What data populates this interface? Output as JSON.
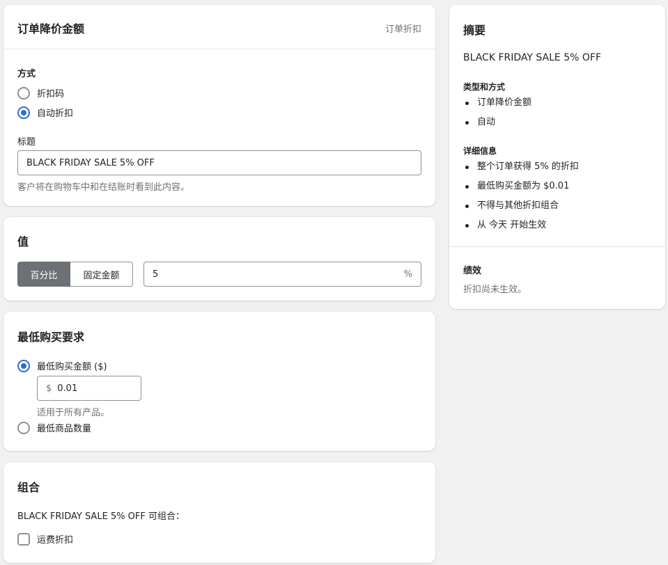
{
  "method_card": {
    "title": "订单降价金额",
    "tag": "订单折扣",
    "method_label": "方式",
    "option_code": "折扣码",
    "option_auto": "自动折扣",
    "title_label": "标题",
    "title_value": "BLACK FRIDAY SALE 5% OFF",
    "help_text": "客户将在购物车中和在结账时看到此内容。"
  },
  "value_card": {
    "title": "值",
    "percent_label": "百分比",
    "fixed_label": "固定金额",
    "value": "5",
    "suffix": "%"
  },
  "min_card": {
    "title": "最低购买要求",
    "option_amount": "最低购买金额 ($)",
    "currency": "$",
    "amount_value": "0.01",
    "help_text": "适用于所有产品。",
    "option_qty": "最低商品数量"
  },
  "combo_card": {
    "title": "组合",
    "text": "BLACK FRIDAY SALE 5% OFF 可组合：",
    "shipping_label": "运费折扣"
  },
  "summary": {
    "title": "摘要",
    "discount_name": "BLACK FRIDAY SALE 5% OFF",
    "type_title": "类型和方式",
    "type_items": [
      "订单降价金额",
      "自动"
    ],
    "details_title": "详细信息",
    "details_items": [
      "整个订单获得 5% 的折扣",
      "最低购买金额为 $0.01",
      "不得与其他折扣组合",
      "从 今天 开始生效"
    ],
    "performance_title": "绩效",
    "performance_text": "折扣尚未生效。"
  },
  "colors": {
    "accent": "#2c6ecb",
    "selected_segment": "#6d7175",
    "background": "#f1f1f1"
  }
}
